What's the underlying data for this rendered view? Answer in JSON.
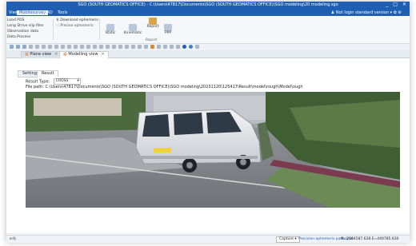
{
  "app": {
    "title": "SGO (SOUTH GEOMATICS OFFICE) - C:\\Users\\47817\\Documents\\SGO (SOUTH GEOMATICS OFFICE)\\SGO modeling\\20 modeling.sgo",
    "account_label": "Not login standard version",
    "window_controls": [
      "_",
      "□",
      "✕"
    ]
  },
  "menu": {
    "items": [
      "View",
      "Mobilesurvey",
      "CAD",
      "Tools"
    ],
    "active": "Mobilesurvey"
  },
  "ribbon": {
    "left_items": [
      "Load POS",
      "Long Strive slip files",
      "Observation data",
      "Data Process"
    ],
    "download_ephemeris": "Download ephemeris",
    "precise_ephemeris": "Precise ephemeris",
    "static": "Static",
    "kinematic": "Kinematic",
    "report": "Report",
    "ppp": "PPP",
    "report_caption": "Report"
  },
  "doc_tabs": {
    "plane_view": "Plane view",
    "modelling_view": "Modelling view"
  },
  "sub_tabs": {
    "setting": "Setting",
    "result": "Result"
  },
  "result": {
    "type_label": "Result Type:",
    "type_value": "CROSS",
    "file_path_label": "File path:",
    "file_path": "C:\\Users\\47817\\Documents\\SGO (SOUTH GEOMATICS OFFICE)\\SGO modeling\\20231120\\125417\\Result\\model\\rough\\Model\\ough"
  },
  "status": {
    "left": "e:0;",
    "capture_box": "Capture",
    "ephemeris": "Precision ephemeris participat",
    "coords": "N=2564587.628  E=440785.630"
  },
  "colors": {
    "accent": "#1e5fb4",
    "background": "#eef1f6"
  }
}
